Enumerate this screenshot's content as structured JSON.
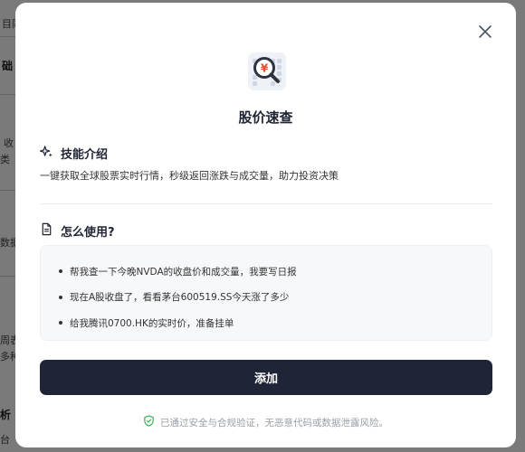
{
  "background": {
    "fragments": [
      "目同",
      "础",
      "收",
      "类",
      "数据",
      "周表",
      "多种",
      "析",
      "台"
    ]
  },
  "modal": {
    "title": "股价速查",
    "skill_icon": "stock-lookup-icon",
    "close_icon": "close-icon",
    "intro": {
      "heading": "技能介绍",
      "icon": "sparkle-icon",
      "text": "一键获取全球股票实时行情，秒级返回涨跌与成交量，助力投资决策"
    },
    "usage": {
      "heading": "怎么使用?",
      "icon": "document-icon",
      "examples": [
        "帮我查一下今晚NVDA的收盘价和成交量，我要写日报",
        "现在A股收盘了，看看茅台600519.SS今天涨了多少",
        "给我腾讯0700.HK的实时价，准备挂单"
      ]
    },
    "add_button": "添加",
    "notice": "已通过安全与合规验证，无恶意代码或数据泄露风险。",
    "colors": {
      "button_bg": "#1f2537",
      "shield": "#3fae5a",
      "icon_accent": "#e04b3a"
    }
  }
}
